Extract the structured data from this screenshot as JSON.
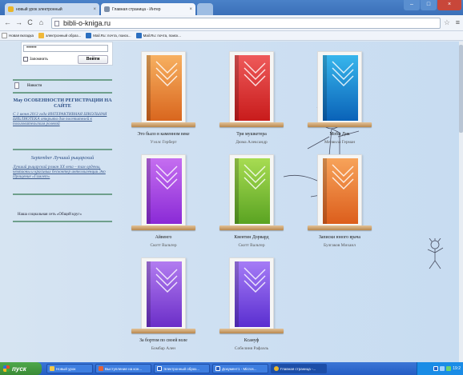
{
  "browser": {
    "tabs": [
      {
        "label": "новый урок электронный",
        "favicon_color": "#e9b62a",
        "close": "×"
      },
      {
        "label": "Главная страница - Интер",
        "favicon_color": "#7d8fa8",
        "close": "×"
      }
    ],
    "new_tab_icon": "new-tab-icon",
    "window_controls": [
      "–",
      "□",
      "×"
    ],
    "nav": {
      "back": "←",
      "forward": "→",
      "reload": "C",
      "home": "⌂"
    },
    "url": "bibli-o-kniga.ru",
    "star_icon": "☆",
    "wrench_icon": "≡"
  },
  "bookmarks": [
    {
      "label": "Новая вкладка",
      "color": "#ffffff"
    },
    {
      "label": "электронный образ...",
      "color": "#f0b83a"
    },
    {
      "label": "Mail.Ru: почта, поиск...",
      "color": "#2b6fc0"
    },
    {
      "label": "Mail.Ru: почта, поиск...",
      "color": "#2b6fc0"
    }
  ],
  "sidebar": {
    "password_mask": "••••••",
    "remember_label": "Запомнить",
    "login_button": "Войти",
    "news_link": "Новости",
    "news_items": [
      {
        "title": "Мау ОСОБЕННОСТИ РЕГИСТРАЦИИ НА САЙТЕ",
        "body": "С 1 июня 2013 года ИНТЕРАКТИВНАЯ ШКОЛЬНАЯ БИБЛИОТЕКА открыта для посетителей к пользовательским ролевой"
      },
      {
        "title": "September Лучший рыцарский",
        "body": "Лучший рыцарский роман XX века – там ордены, чемпионы и красивых бесконтер интеллигенции Эко Прощение «Гамлет»"
      }
    ],
    "social_label": "Наша социальная сеть «Общий круг»"
  },
  "books": [
    {
      "title": "Это было в каменном веке",
      "author": "Уэллс Герберт",
      "color_top": "#f7b060",
      "color_bottom": "#d9661e"
    },
    {
      "title": "Три мушкетера",
      "author": "Дюма Александр",
      "color_top": "#ee5a5a",
      "color_bottom": "#c81b1b"
    },
    {
      "title": "Моби Дик",
      "author": "Мелвилл Герман",
      "color_top": "#37b6ec",
      "color_bottom": "#0a62b8"
    },
    {
      "title": "Айвенго",
      "author": "Скотт Вальтер",
      "color_top": "#c56ef0",
      "color_bottom": "#8a2ad6"
    },
    {
      "title": "Квентин Дорвард",
      "author": "Скотт Вальтер",
      "color_top": "#a7dc52",
      "color_bottom": "#5aa322"
    },
    {
      "title": "Записки юного врача",
      "author": "Булгаков Михаил",
      "color_top": "#f7a35a",
      "color_bottom": "#dc5e1c"
    },
    {
      "title": "За бортом по своей воле",
      "author": "Бомбар Ален",
      "color_top": "#b27cf0",
      "color_bottom": "#6b2ec8"
    },
    {
      "title": "Ксануф",
      "author": "Собелиня Рафаэль",
      "color_top": "#a57cf6",
      "color_bottom": "#5a2ed0"
    }
  ],
  "taskbar": {
    "start_label": "пуск",
    "tasks": [
      {
        "label": "Новый урок",
        "color": "#f2c94a"
      },
      {
        "label": "Выступление на кон...",
        "color": "#4b8ce0"
      },
      {
        "label": "Электронный образ...",
        "color": "#2b5fbf"
      },
      {
        "label": "Документ1 - Micros...",
        "color": "#2b5fbf"
      },
      {
        "label": "Главная страница -...",
        "color": "#e9b62a"
      }
    ],
    "clock": "19:2"
  }
}
